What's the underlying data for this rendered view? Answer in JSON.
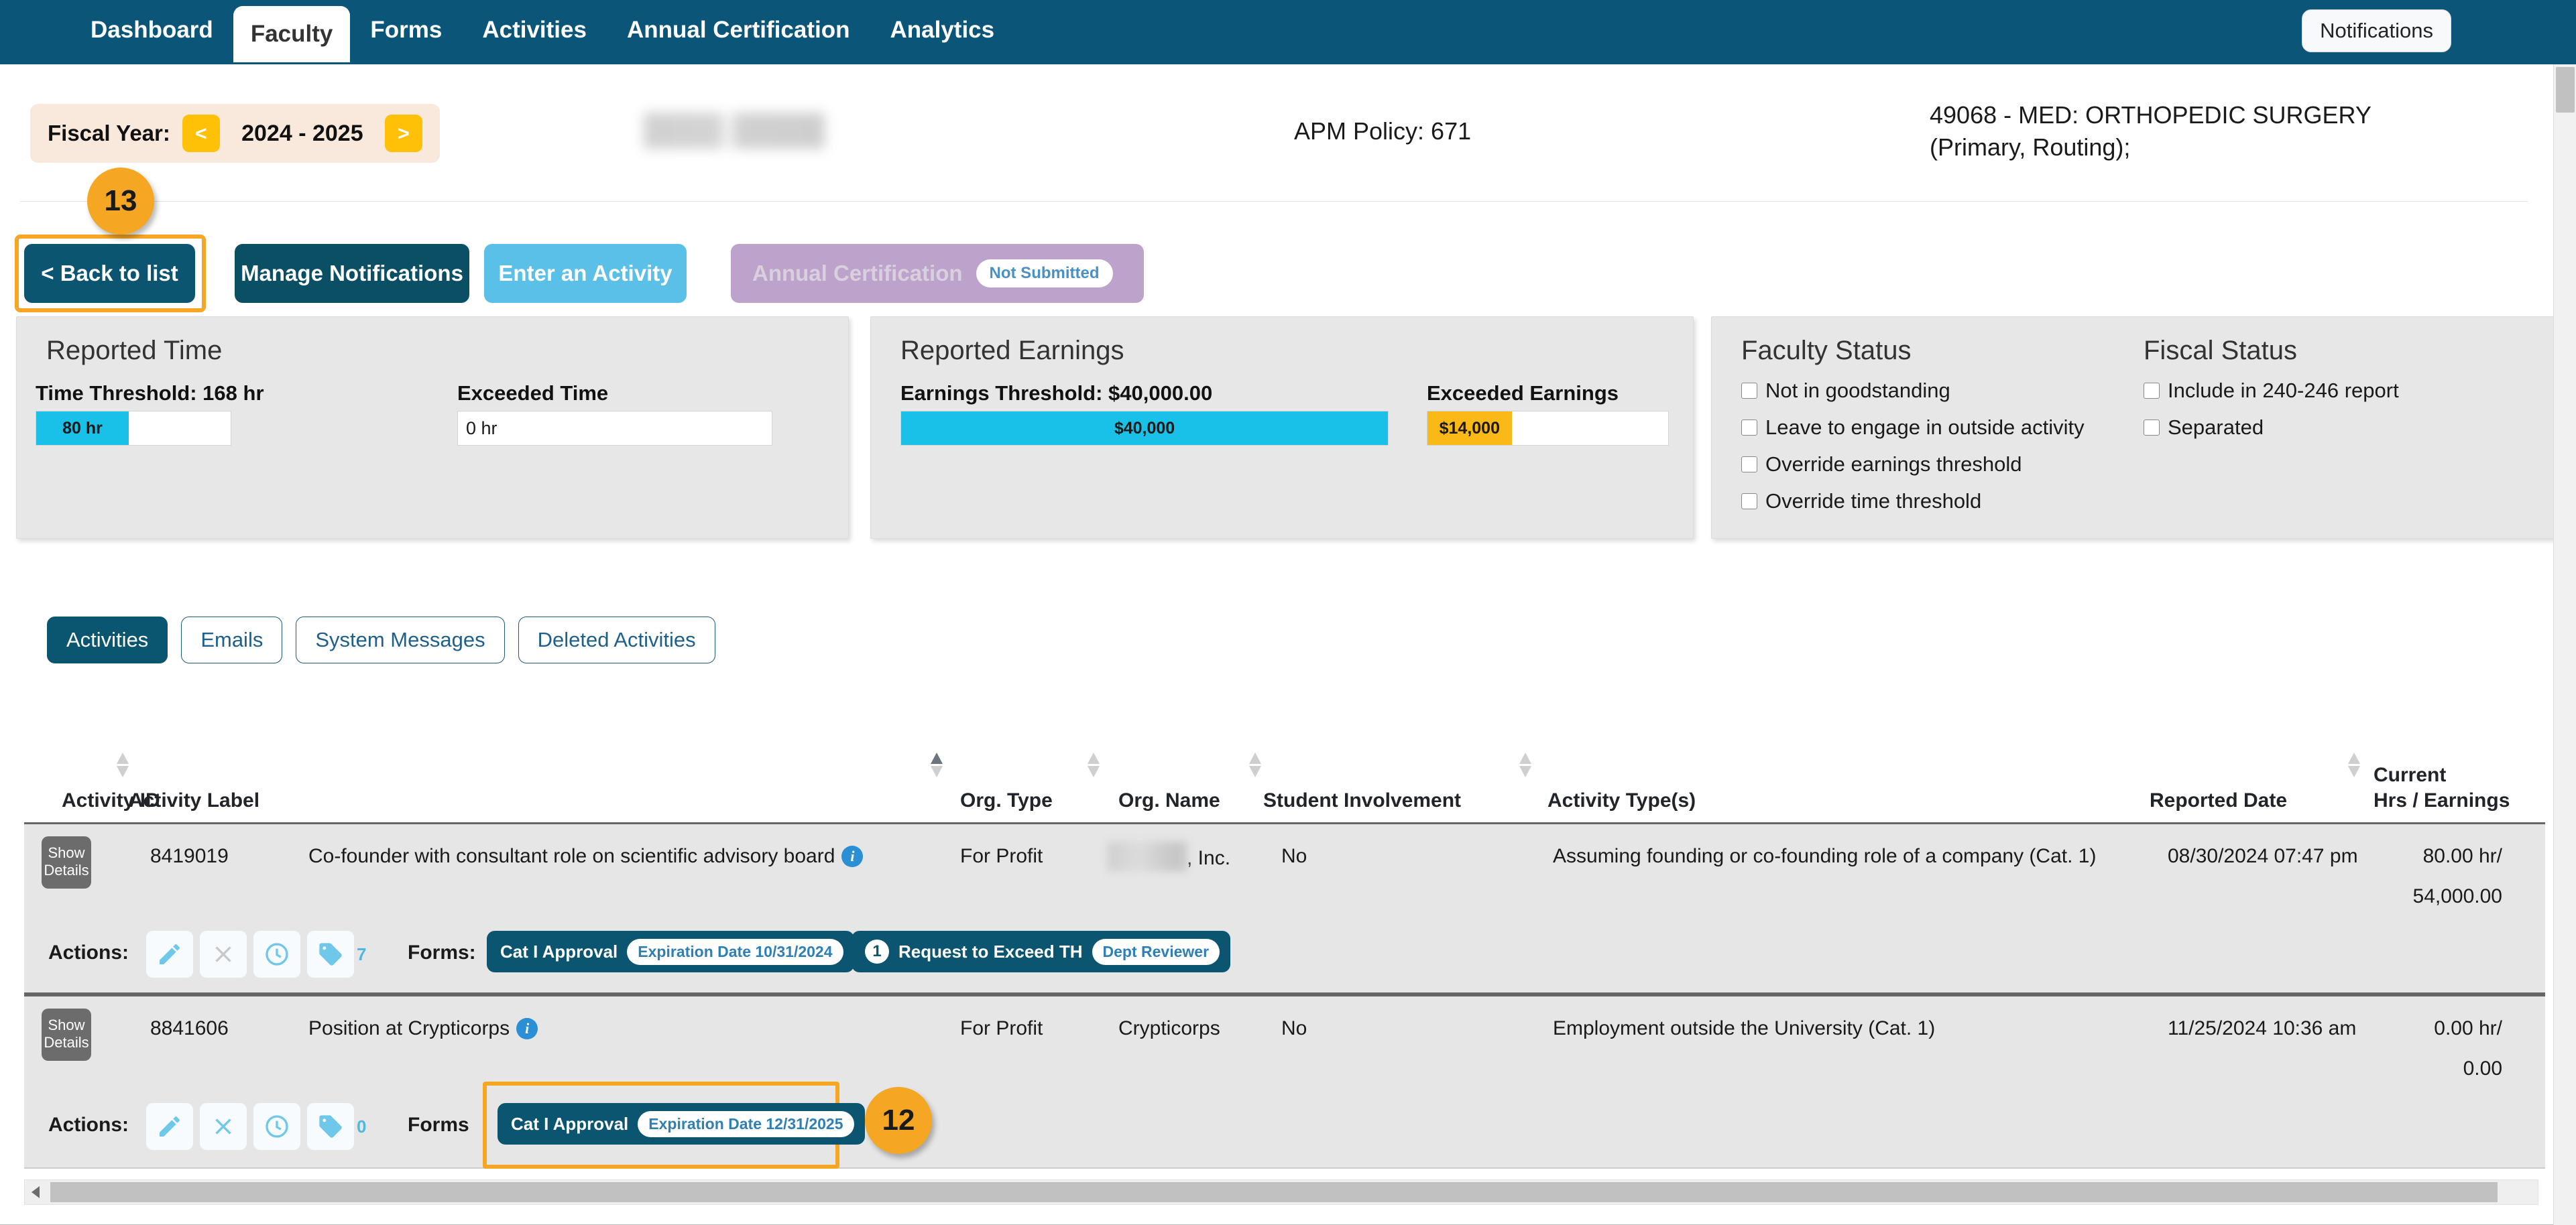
{
  "topnav": {
    "items": [
      {
        "label": "Dashboard",
        "active": false
      },
      {
        "label": "Faculty",
        "active": true
      },
      {
        "label": "Forms",
        "active": false
      },
      {
        "label": "Activities",
        "active": false
      },
      {
        "label": "Annual Certification",
        "active": false
      },
      {
        "label": "Analytics",
        "active": false
      }
    ],
    "notifications_label": "Notifications",
    "brand_color": "#0b5578"
  },
  "header": {
    "fiscal_year_label": "Fiscal Year:",
    "fiscal_year_value": "2024 - 2025",
    "prev_arrow": "<",
    "next_arrow": ">",
    "apm_policy": "APM Policy: 671",
    "department_line1": "49068 - MED: ORTHOPEDIC SURGERY",
    "department_line2": "(Primary, Routing);"
  },
  "callouts": [
    {
      "id": "13",
      "number": "13"
    },
    {
      "id": "12",
      "number": "12"
    }
  ],
  "action_buttons": {
    "back": "< Back to list",
    "manage_notifications": "Manage Notifications",
    "enter_activity": "Enter an Activity",
    "annual_certification": "Annual Certification",
    "annual_certification_badge": "Not Submitted"
  },
  "cards": {
    "reported_time": {
      "title": "Reported Time",
      "threshold_label": "Time Threshold: 168 hr",
      "bar_value": "80 hr",
      "bar_percent": 47.6,
      "exceeded_label": "Exceeded Time",
      "exceeded_value": "0 hr"
    },
    "reported_earnings": {
      "title": "Reported Earnings",
      "threshold_label": "Earnings Threshold: $40,000.00",
      "bar_value": "$40,000",
      "bar_percent": 100,
      "exceeded_label": "Exceeded Earnings",
      "exceeded_value": "$14,000",
      "exceeded_percent": 35
    },
    "faculty_status": {
      "title": "Faculty Status",
      "options": [
        {
          "label": "Not in goodstanding",
          "checked": false
        },
        {
          "label": "Leave to engage in outside activity",
          "checked": false
        },
        {
          "label": "Override earnings threshold",
          "checked": false
        },
        {
          "label": "Override time threshold",
          "checked": false
        }
      ]
    },
    "fiscal_status": {
      "title": "Fiscal Status",
      "options": [
        {
          "label": "Include in 240-246 report",
          "checked": false
        },
        {
          "label": "Separated",
          "checked": false
        }
      ]
    }
  },
  "tabs": [
    {
      "label": "Activities",
      "active": true
    },
    {
      "label": "Emails",
      "active": false
    },
    {
      "label": "System Messages",
      "active": false
    },
    {
      "label": "Deleted Activities",
      "active": false
    }
  ],
  "table": {
    "columns": [
      {
        "label": "Activity ID",
        "sortable": false
      },
      {
        "label": "Activity Label",
        "sortable": true,
        "sorted": false
      },
      {
        "label": "Org. Type",
        "sortable": true,
        "sorted": true
      },
      {
        "label": "Org. Name",
        "sortable": true,
        "sorted": false
      },
      {
        "label": "Student Involvement",
        "sortable": true,
        "sorted": false
      },
      {
        "label": "Activity Type(s)",
        "sortable": true,
        "sorted": false
      },
      {
        "label": "Reported Date",
        "sortable": true,
        "sorted": false
      },
      {
        "label": "Current Hrs / Earnings",
        "sortable": false
      }
    ],
    "current_header_line1": "Current",
    "current_header_line2": "Hrs / Earnings",
    "show_details_label_line1": "Show",
    "show_details_label_line2": "Details",
    "actions_label": "Actions:",
    "rows": [
      {
        "activity_id": "8419019",
        "activity_label": "Co-founder with consultant role on scientific advisory board",
        "org_type": "For Profit",
        "org_name": ", Inc.",
        "org_name_redacted": true,
        "student_involvement": "No",
        "activity_types": "Assuming founding or co-founding role of a company (Cat. 1)",
        "reported_date": "08/30/2024 07:47 pm",
        "hours": "80.00 hr/",
        "earnings": "54,000.00",
        "tag_count": "7",
        "forms_label": "Forms:",
        "forms": [
          {
            "name": "Cat I Approval",
            "expiration": "Expiration Date 10/31/2024",
            "count": null,
            "highlighted": false
          },
          {
            "name": "Request to Exceed TH",
            "expiration": "Dept Reviewer",
            "count": "1",
            "highlighted": false
          }
        ]
      },
      {
        "activity_id": "8841606",
        "activity_label": "Position at Crypticorps",
        "org_type": "For Profit",
        "org_name": "Crypticorps",
        "org_name_redacted": false,
        "student_involvement": "No",
        "activity_types": "Employment outside the University (Cat. 1)",
        "reported_date": "11/25/2024 10:36 am",
        "hours": "0.00 hr/",
        "earnings": "0.00",
        "tag_count": "0",
        "forms_label": "Forms",
        "forms": [
          {
            "name": "Cat I Approval",
            "expiration": "Expiration Date 12/31/2025",
            "count": null,
            "highlighted": true
          }
        ]
      }
    ]
  },
  "colors": {
    "nav": "#0b5578",
    "primary": "#0b5571",
    "accent_cyan": "#19c0e8",
    "accent_amber": "#fbb917",
    "highlight": "#f5a623",
    "card_bg": "#e7e7e7"
  }
}
